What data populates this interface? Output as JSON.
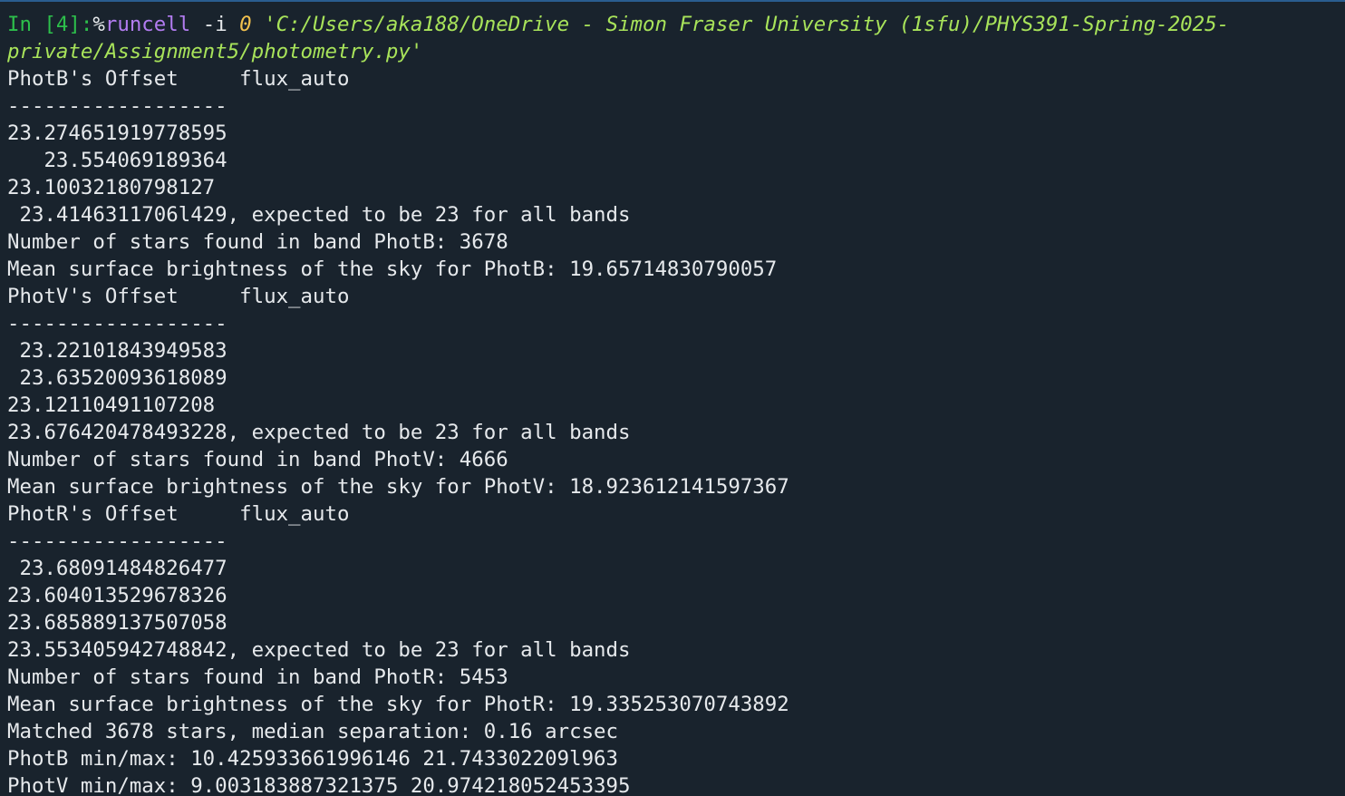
{
  "colors": {
    "background": "#19232d",
    "output_text": "#e6e9ec",
    "prompt": "#2dbf4b",
    "magic": "#b27cf0",
    "number": "#f2c14e",
    "string": "#a8e35a"
  },
  "prompt": {
    "label": "In [4]:",
    "magic_pct": "%",
    "magic_name": "runcell",
    "flag": " -i ",
    "cell_index": "0",
    "path_line1": " 'C:/Users/aka188/OneDrive - Simon Fraser University (1sfu)/PHYS391-Spring-2025-",
    "path_line2": "private/Assignment5/photometry.py'"
  },
  "output": [
    "PhotB's Offset     flux_auto",
    "------------------",
    "23.274651919778595",
    "   23.554069189364",
    "23.10032180798127",
    " 23.4146311706l429, expected to be 23 for all bands",
    "Number of stars found in band PhotB: 3678",
    "Mean surface brightness of the sky for PhotB: 19.65714830790057",
    "PhotV's Offset     flux_auto",
    "------------------",
    " 23.22101843949583",
    " 23.63520093618089",
    "23.12110491107208",
    "23.676420478493228, expected to be 23 for all bands",
    "Number of stars found in band PhotV: 4666",
    "Mean surface brightness of the sky for PhotV: 18.923612141597367",
    "PhotR's Offset     flux_auto",
    "------------------",
    " 23.68091484826477",
    "23.604013529678326",
    "23.685889137507058",
    "23.553405942748842, expected to be 23 for all bands",
    "Number of stars found in band PhotR: 5453",
    "Mean surface brightness of the sky for PhotR: 19.335253070743892",
    "Matched 3678 stars, median separation: 0.16 arcsec",
    "PhotB min/max: 10.425933661996146 21.743302209l963",
    "PhotV min/max: 9.003183887321375 20.974218052453395"
  ]
}
